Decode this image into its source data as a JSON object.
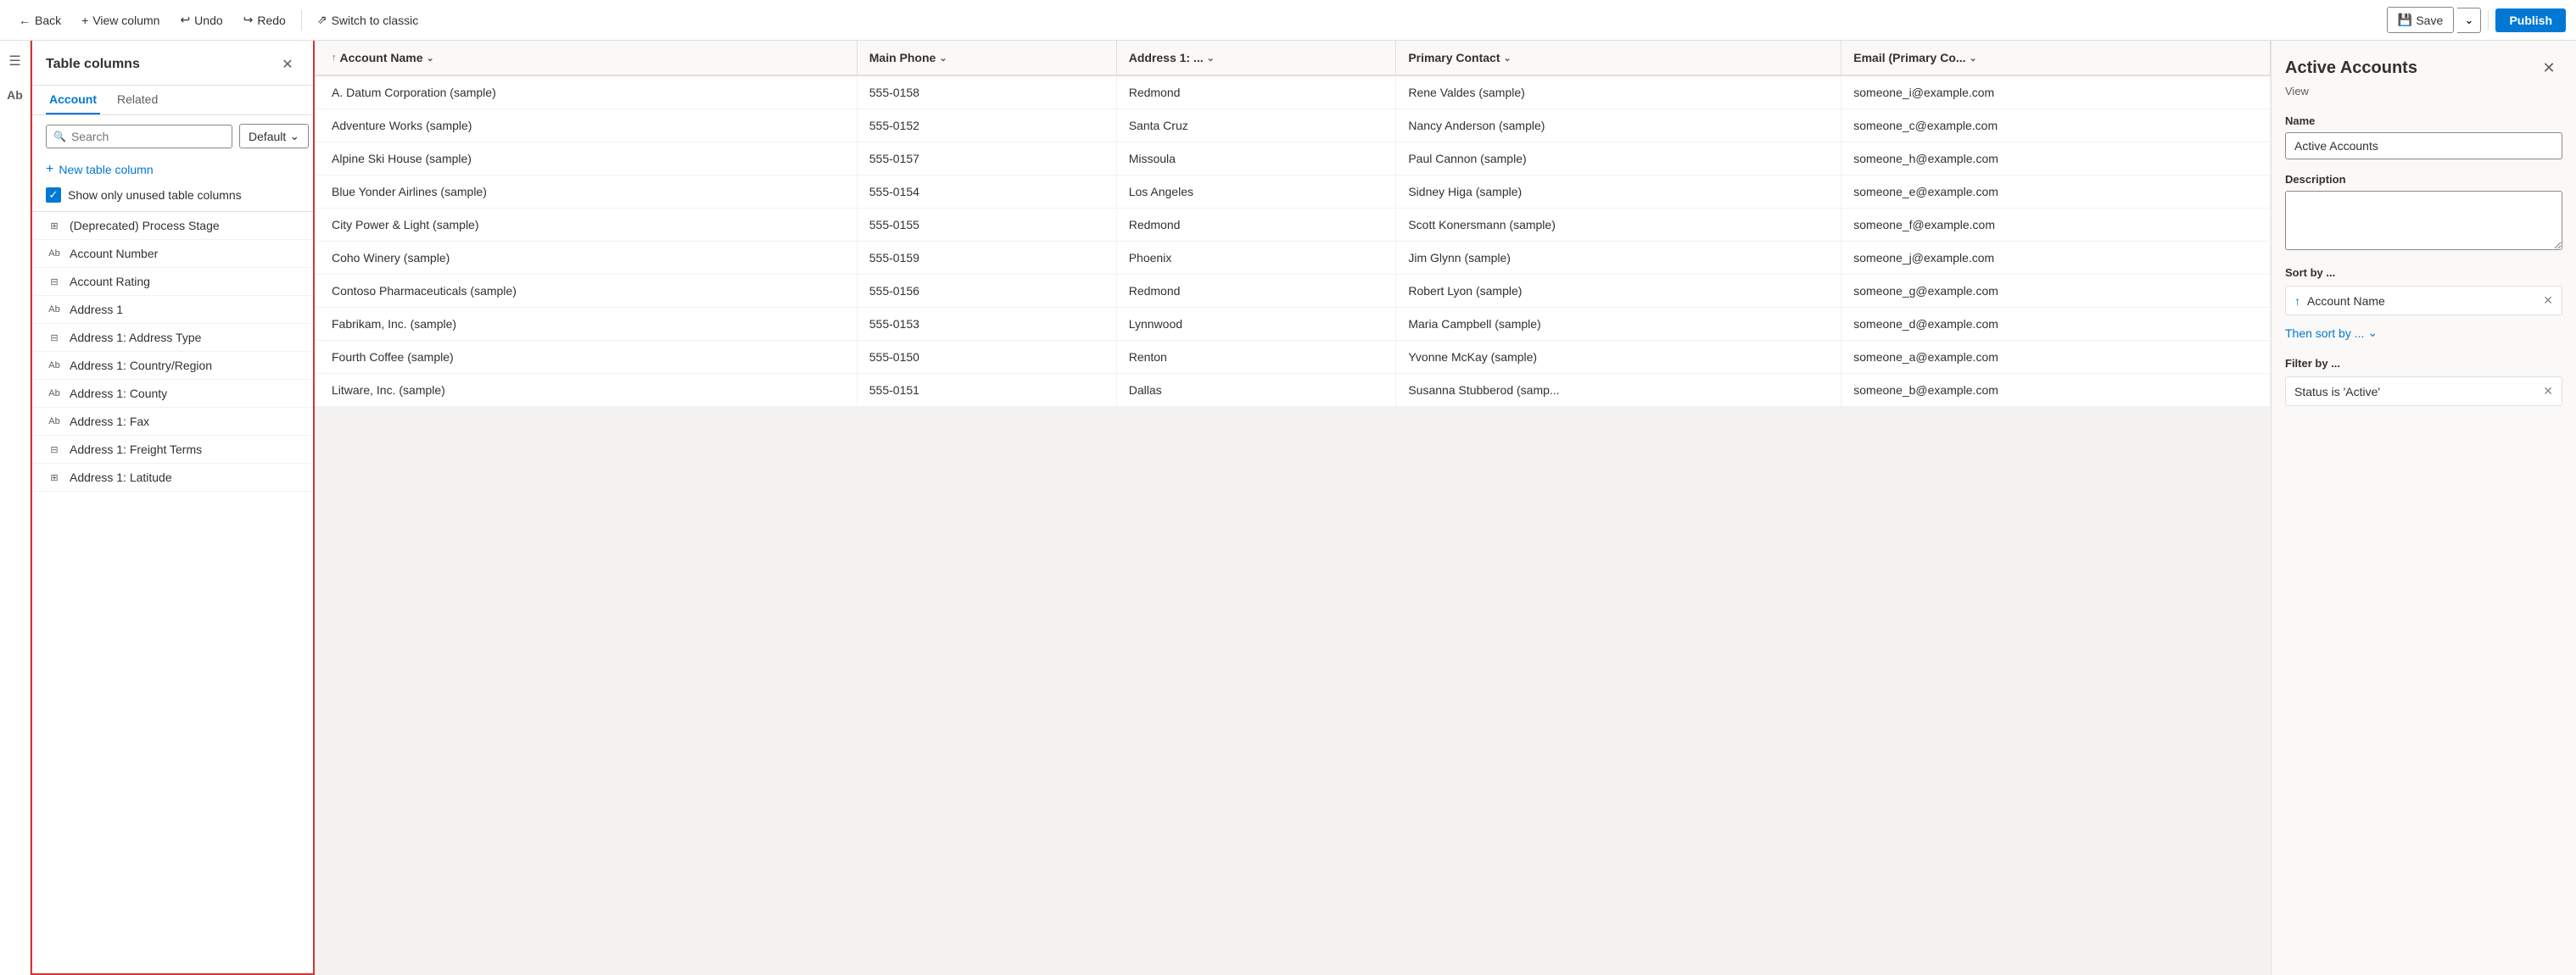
{
  "toolbar": {
    "back_label": "Back",
    "view_column_label": "View column",
    "undo_label": "Undo",
    "redo_label": "Redo",
    "switch_classic_label": "Switch to classic",
    "save_label": "Save",
    "publish_label": "Publish"
  },
  "panel": {
    "title": "Table columns",
    "tab_account": "Account",
    "tab_related": "Related",
    "search_placeholder": "Search",
    "default_label": "Default",
    "new_column_label": "New table column",
    "checkbox_label": "Show only unused table columns",
    "columns": [
      {
        "icon": "grid-icon",
        "name": "(Deprecated) Process Stage"
      },
      {
        "icon": "text-icon",
        "name": "Account Number"
      },
      {
        "icon": "option-icon",
        "name": "Account Rating"
      },
      {
        "icon": "text-icon",
        "name": "Address 1"
      },
      {
        "icon": "option-icon",
        "name": "Address 1: Address Type"
      },
      {
        "icon": "text-icon",
        "name": "Address 1: Country/Region"
      },
      {
        "icon": "text-icon",
        "name": "Address 1: County"
      },
      {
        "icon": "text-icon",
        "name": "Address 1: Fax"
      },
      {
        "icon": "option-icon",
        "name": "Address 1: Freight Terms"
      },
      {
        "icon": "grid-icon",
        "name": "Address 1: Latitude"
      }
    ]
  },
  "grid": {
    "columns": [
      {
        "label": "Account Name",
        "has_sort": true,
        "has_chevron": true
      },
      {
        "label": "Main Phone",
        "has_sort": false,
        "has_chevron": true
      },
      {
        "label": "Address 1: ...",
        "has_sort": false,
        "has_chevron": true
      },
      {
        "label": "Primary Contact",
        "has_sort": false,
        "has_chevron": true
      },
      {
        "label": "Email (Primary Co...",
        "has_sort": false,
        "has_chevron": true
      }
    ],
    "rows": [
      {
        "account": "A. Datum Corporation (sample)",
        "phone": "555-0158",
        "address": "Redmond",
        "contact": "Rene Valdes (sample)",
        "email": "someone_i@example.com"
      },
      {
        "account": "Adventure Works (sample)",
        "phone": "555-0152",
        "address": "Santa Cruz",
        "contact": "Nancy Anderson (sample)",
        "email": "someone_c@example.com"
      },
      {
        "account": "Alpine Ski House (sample)",
        "phone": "555-0157",
        "address": "Missoula",
        "contact": "Paul Cannon (sample)",
        "email": "someone_h@example.com"
      },
      {
        "account": "Blue Yonder Airlines (sample)",
        "phone": "555-0154",
        "address": "Los Angeles",
        "contact": "Sidney Higa (sample)",
        "email": "someone_e@example.com"
      },
      {
        "account": "City Power & Light (sample)",
        "phone": "555-0155",
        "address": "Redmond",
        "contact": "Scott Konersmann (sample)",
        "email": "someone_f@example.com"
      },
      {
        "account": "Coho Winery (sample)",
        "phone": "555-0159",
        "address": "Phoenix",
        "contact": "Jim Glynn (sample)",
        "email": "someone_j@example.com"
      },
      {
        "account": "Contoso Pharmaceuticals (sample)",
        "phone": "555-0156",
        "address": "Redmond",
        "contact": "Robert Lyon (sample)",
        "email": "someone_g@example.com"
      },
      {
        "account": "Fabrikam, Inc. (sample)",
        "phone": "555-0153",
        "address": "Lynnwood",
        "contact": "Maria Campbell (sample)",
        "email": "someone_d@example.com"
      },
      {
        "account": "Fourth Coffee (sample)",
        "phone": "555-0150",
        "address": "Renton",
        "contact": "Yvonne McKay (sample)",
        "email": "someone_a@example.com"
      },
      {
        "account": "Litware, Inc. (sample)",
        "phone": "555-0151",
        "address": "Dallas",
        "contact": "Susanna Stubberod (samp...",
        "email": "someone_b@example.com"
      }
    ]
  },
  "right_panel": {
    "title": "Active Accounts",
    "subtitle": "View",
    "close_icon": "✕",
    "name_label": "Name",
    "name_value": "Active Accounts",
    "description_label": "Description",
    "description_placeholder": "",
    "sort_label": "Sort by ...",
    "sort_field": "Account Name",
    "then_sort_label": "Then sort by ...",
    "filter_label": "Filter by ...",
    "filter_value": "Status is 'Active'"
  }
}
